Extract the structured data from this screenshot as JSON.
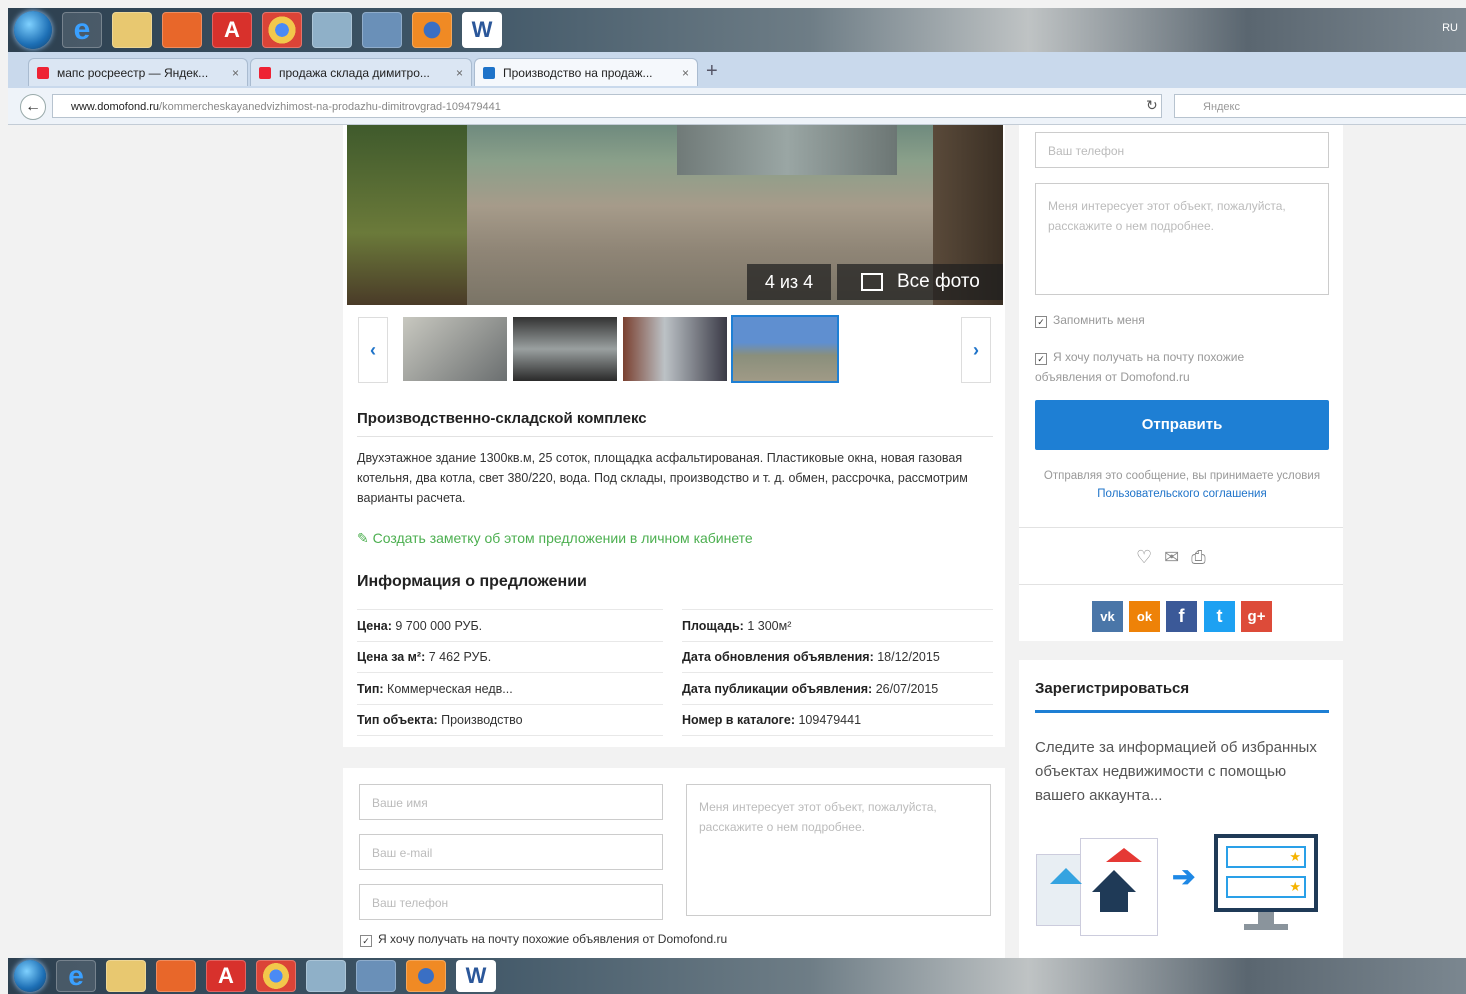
{
  "taskbar": {
    "lang": "RU",
    "apps": [
      "start-orb",
      "ie",
      "explorer",
      "media",
      "acrobat",
      "chrome",
      "tool",
      "screen",
      "firefox",
      "word"
    ]
  },
  "browser": {
    "tabs": [
      {
        "label": "мапс росреестр — Яндек...",
        "close": "×"
      },
      {
        "label": "продажа склада димитро...",
        "close": "×"
      },
      {
        "label": "Производство на продаж...",
        "close": "×"
      }
    ],
    "new_tab": "+",
    "url_domain": "www.domofond.ru",
    "url_path": "/kommercheskayanedvizhimost-na-prodazhu-dimitrovgrad-109479441",
    "search_placeholder": "Яндекс"
  },
  "gallery": {
    "counter": "4 из 4",
    "all_photos": "Все фото",
    "prev": "‹",
    "next": "›"
  },
  "listing": {
    "title": "Производственно-складской комплекс",
    "description": "Двухэтажное здание 1300кв.м, 25 соток, площадка асфальтированая. Пластиковые окна, новая газовая котельня, два котла, свет 380/220, вода. Под склады, производство и т. д. обмен, рассрочка, рассмотрим варианты расчета.",
    "note_link": "Создать заметку об этом предложении в личном кабинете"
  },
  "info": {
    "heading": "Информация о предложении",
    "left": [
      {
        "label": "Цена:",
        "value": " 9 700 000 РУБ."
      },
      {
        "label": "Цена за м²:",
        "value": " 7 462 РУБ."
      },
      {
        "label": "Тип:",
        "value": " Коммерческая недв..."
      },
      {
        "label": "Тип объекта:",
        "value": " Производство"
      }
    ],
    "right": [
      {
        "label": "Площадь:",
        "value": " 1 300м²"
      },
      {
        "label": "Дата обновления объявления:",
        "value": " 18/12/2015"
      },
      {
        "label": "Дата публикации объявления:",
        "value": " 26/07/2015"
      },
      {
        "label": "Номер в каталоге:",
        "value": " 109479441"
      }
    ]
  },
  "bottom_form": {
    "name_placeholder": "Ваше имя",
    "email_placeholder": "Ваш e-mail",
    "phone_placeholder": "Ваш телефон",
    "message_placeholder": "Меня интересует этот объект, пожалуйста, расскажите о нем подробнее.",
    "subscribe_label": "Я хочу получать на почту похожие объявления от Domofond.ru"
  },
  "side_form": {
    "phone_placeholder": "Ваш телефон",
    "message_placeholder": "Меня интересует этот объект, пожалуйста, расскажите о нем подробнее.",
    "remember_label": "Запомнить меня",
    "subscribe_label": "Я хочу получать на почту похожие объявления от Domofond.ru",
    "send_label": "Отправить",
    "terms_text": "Отправляя это сообщение, вы принимаете условия",
    "terms_link": "Пользовательского соглашения"
  },
  "social": {
    "vk": "vk",
    "ok": "ok",
    "fb": "f",
    "tw": "t",
    "gp": "g+"
  },
  "register": {
    "title": "Зарегистрироваться",
    "text": "Следите за информацией об избранных объектах недвижимости с помощью вашего аккаунта..."
  },
  "colors": {
    "accent": "#1e7fd4",
    "note": "#4caf50",
    "vk": "#4a76a8",
    "ok": "#ee8208",
    "fb": "#3b5998",
    "tw": "#1da1f2",
    "gp": "#dd4b39"
  }
}
